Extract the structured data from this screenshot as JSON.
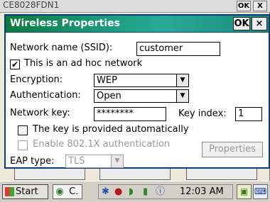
{
  "background_window": {
    "title": "CE8028FDN1",
    "ok_label": "OK",
    "close_label": "X"
  },
  "dialog": {
    "title": "Wireless Properties",
    "ok_label": "OK",
    "close_label": "×",
    "ssid_label": "Network name (SSID):",
    "ssid_value": "customer",
    "adhoc_label": "This is an ad hoc network",
    "adhoc_checked": true,
    "encryption_label": "Encryption:",
    "encryption_value": "WEP",
    "authentication_label": "Authentication:",
    "authentication_value": "Open",
    "network_key_label": "Network key:",
    "network_key_value": "********",
    "key_index_label": "Key index:",
    "key_index_value": "1",
    "key_auto_label": "The key is provided automatically",
    "key_auto_checked": false,
    "enable_8021x_label": "Enable 802.1X authentication",
    "enable_8021x_checked": false,
    "eap_type_label": "EAP type:",
    "eap_type_value": "TLS",
    "properties_label": "Properties"
  },
  "taskbar": {
    "start_label": "Start",
    "task_item_label": "C.",
    "clock": "12:03 AM"
  },
  "icons": {
    "start": "windows-flag-icon",
    "task": "settings-app-icon",
    "tray": [
      "bluetooth-icon",
      "network-icon",
      "wireless-icon",
      "power-icon",
      "info-icon"
    ],
    "desktop": "desktop-icon",
    "keyboard": "keyboard-icon"
  }
}
